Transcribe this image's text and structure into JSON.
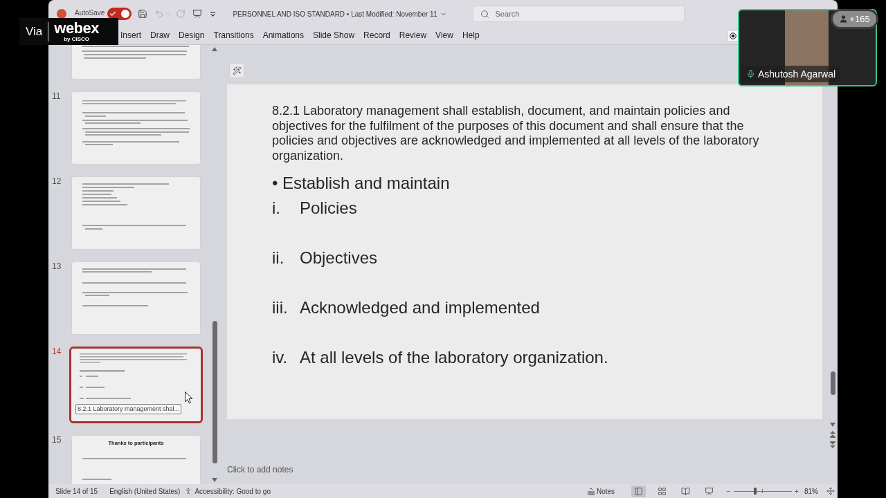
{
  "overlay": {
    "via": "Via",
    "brand": "webex",
    "brand_sub": "by CISCO"
  },
  "title_bar": {
    "autosave_label": "AutoSave",
    "autosave_on": true,
    "quick_access": [
      {
        "kind": "save",
        "disabled": false
      },
      {
        "kind": "undo",
        "disabled": true
      },
      {
        "kind": "redo",
        "disabled": true
      },
      {
        "kind": "present",
        "disabled": false
      },
      {
        "kind": "customize",
        "disabled": false
      }
    ],
    "title": "PERSONNEL AND ISO STANDARD • Last Modified: November 11"
  },
  "search": {
    "placeholder": "Search"
  },
  "ribbon_tabs": [
    {
      "label": "Insert",
      "selected": false
    },
    {
      "label": "Draw",
      "selected": false
    },
    {
      "label": "Design",
      "selected": false
    },
    {
      "label": "Transitions",
      "selected": false
    },
    {
      "label": "Animations",
      "selected": false
    },
    {
      "label": "Slide Show",
      "selected": false
    },
    {
      "label": "Record",
      "selected": false
    },
    {
      "label": "Review",
      "selected": false
    },
    {
      "label": "View",
      "selected": false
    },
    {
      "label": "Help",
      "selected": false
    }
  ],
  "thumbnails": [
    {
      "kind": "partial",
      "selected": false
    },
    {
      "kind": "bullets",
      "number": "11",
      "selected": false
    },
    {
      "kind": "list",
      "number": "12",
      "selected": false
    },
    {
      "kind": "spaced",
      "number": "13",
      "selected": false
    },
    {
      "kind": "numbered",
      "number": "14",
      "selected": true,
      "tooltip": "8.2.1 Laboratory management shal..."
    },
    {
      "kind": "closing",
      "number": "15",
      "selected": false,
      "title": "Thanks to participants"
    }
  ],
  "slide": {
    "paragraph": "8.2.1 Laboratory management shall establish, document, and maintain policies and objectives for the fulfilment of the purposes of this document and shall ensure that the policies and objectives are acknowledged and implemented at all levels of the laboratory organization.",
    "bullet": "• Establish and maintain",
    "items": [
      {
        "numeral": "i.",
        "text": "Policies"
      },
      {
        "numeral": "ii.",
        "text": "Objectives"
      },
      {
        "numeral": "iii.",
        "text": "Acknowledged and implemented"
      },
      {
        "numeral": "iv.",
        "text": "At all levels of the laboratory organization."
      }
    ]
  },
  "notes": {
    "placeholder": "Click to add notes"
  },
  "status_bar": {
    "slide_info": "Slide 14 of 15",
    "language": "English (United States)",
    "accessibility": "Accessibility: Good to go",
    "notes": "Notes",
    "views": [
      {
        "kind": "normal",
        "selected": true
      },
      {
        "kind": "sorter",
        "selected": false
      },
      {
        "kind": "reading",
        "selected": false
      },
      {
        "kind": "presenter",
        "selected": false
      }
    ],
    "zoom": {
      "minus": "−",
      "plus": "+",
      "level": 0.38,
      "reading": "81%"
    }
  },
  "video_tile": {
    "name": "Ashutosh Agarwal",
    "participants": "+165"
  }
}
